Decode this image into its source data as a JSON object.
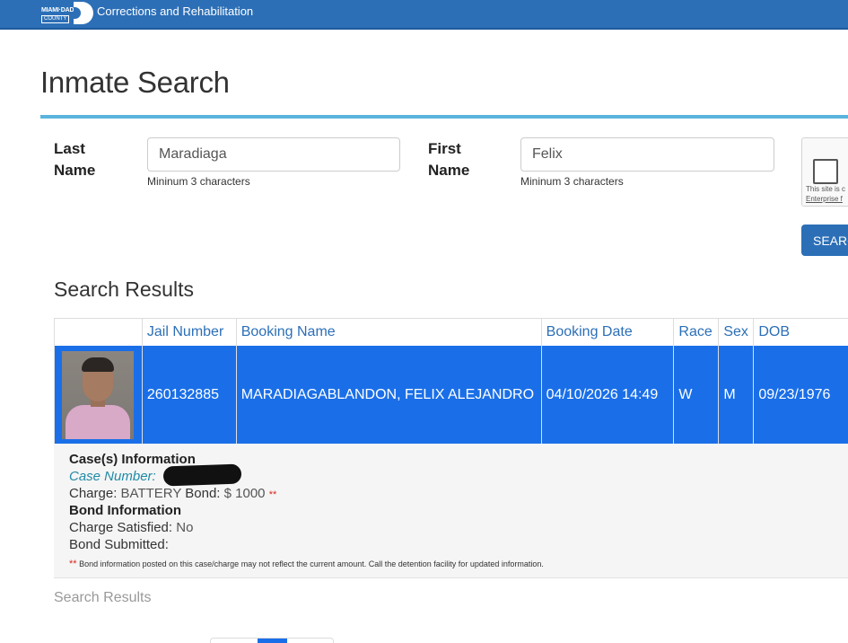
{
  "header": {
    "logo_line1": "MIAMI·DADE",
    "logo_line2": "COUNTY",
    "department": "Corrections and Rehabilitation",
    "bar_color": "#2c6fb7"
  },
  "page_title": "Inmate Search",
  "search_form": {
    "last_name": {
      "label": "Last Name",
      "value": "Maradiaga",
      "hint": "Mininum 3 characters"
    },
    "first_name": {
      "label": "First Name",
      "value": "Felix",
      "hint": "Mininum 3 characters"
    },
    "captcha": {
      "note": "This site is c",
      "link": "Enterprise f"
    },
    "search_button": "SEARC"
  },
  "results": {
    "title": "Search Results",
    "columns": [
      "",
      "Jail Number",
      "Booking Name",
      "Booking Date",
      "Race",
      "Sex",
      "DOB"
    ],
    "rows": [
      {
        "photo": "inmate-photo",
        "jail_number": "260132885",
        "booking_name": "MARADIAGABLANDON, FELIX ALEJANDRO",
        "booking_date": "04/10/2026 14:49",
        "race": "W",
        "sex": "M",
        "dob": "09/23/1976"
      }
    ],
    "selected_row_color": "#1a6fe8",
    "details": {
      "cases_heading": "Case(s) Information",
      "case_number_label": "Case Number:",
      "charge_label": "Charge:",
      "charge_value": "BATTERY",
      "bond_label": "Bond:",
      "bond_value": "$ 1000",
      "bond_marker": "**",
      "bond_heading": "Bond Information",
      "charge_satisfied_label": "Charge Satisfied:",
      "charge_satisfied_value": "No",
      "bond_submitted_label": "Bond Submitted:",
      "footnote_marker": "**",
      "footnote": "Bond information posted on this case/charge may not reflect the current amount. Call the detention facility for updated information."
    },
    "summary": "Search Results"
  }
}
